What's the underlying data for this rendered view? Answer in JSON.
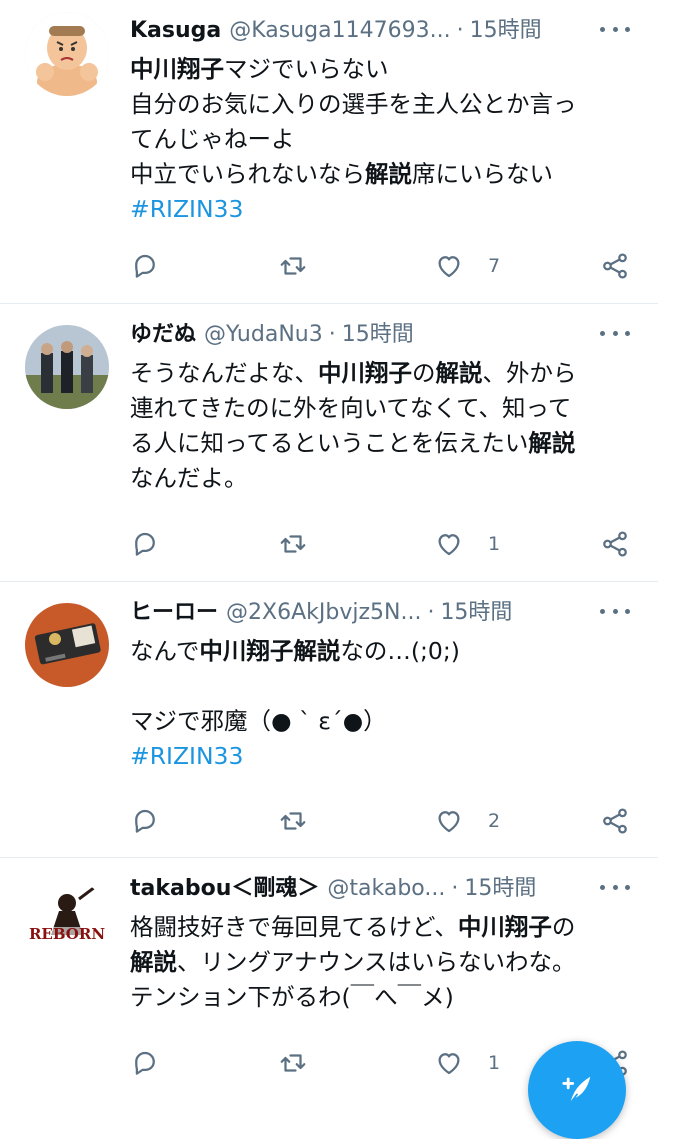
{
  "tweets": [
    {
      "name": "Kasuga",
      "handle": "@Kasuga1147693...",
      "sep": "·",
      "time": "15時間",
      "lines": [
        [
          {
            "t": "中川翔子",
            "s": "hl"
          },
          {
            "t": "マジでいらない"
          }
        ],
        [
          {
            "t": "自分のお気に入りの選手を主人公とか言っ"
          }
        ],
        [
          {
            "t": "てんじゃねーよ"
          }
        ],
        [
          {
            "t": "中立でいられないなら"
          },
          {
            "t": "解説",
            "s": "hl"
          },
          {
            "t": "席にいらない"
          }
        ],
        [
          {
            "t": "#RIZIN33",
            "s": "tag"
          }
        ]
      ],
      "likes": "7"
    },
    {
      "name": "ゆだぬ",
      "handle": "@YudaNu3",
      "sep": "·",
      "time": "15時間",
      "lines": [
        [
          {
            "t": "そうなんだよな、"
          },
          {
            "t": "中川翔子",
            "s": "hl"
          },
          {
            "t": "の"
          },
          {
            "t": "解説",
            "s": "hl"
          },
          {
            "t": "、外から"
          }
        ],
        [
          {
            "t": "連れてきたのに外を向いてなくて、知って"
          }
        ],
        [
          {
            "t": "る人に知ってるということを伝えたい"
          },
          {
            "t": "解説",
            "s": "hl"
          }
        ],
        [
          {
            "t": "なんだよ。"
          }
        ]
      ],
      "likes": "1"
    },
    {
      "name": "ヒーロー",
      "handle": "@2X6AkJbvjz5N...",
      "sep": "·",
      "time": "15時間",
      "lines": [
        [
          {
            "t": "なんで"
          },
          {
            "t": "中川翔子解説",
            "s": "hl"
          },
          {
            "t": "なの…(;0;)"
          }
        ],
        [
          {
            "t": ""
          }
        ],
        [
          {
            "t": "マジで邪魔（● ` ε´●）"
          }
        ],
        [
          {
            "t": "#RIZIN33",
            "s": "tag"
          }
        ]
      ],
      "likes": "2"
    },
    {
      "name": "takabou＜剛魂＞",
      "handle": "@takabo...",
      "sep": "·",
      "time": "15時間",
      "lines": [
        [
          {
            "t": "格闘技好きで毎回見てるけど、"
          },
          {
            "t": "中川翔子",
            "s": "hl"
          },
          {
            "t": "の"
          }
        ],
        [
          {
            "t": "解説",
            "s": "hl"
          },
          {
            "t": "、リングアナウンスはいらないわな。"
          }
        ],
        [
          {
            "t": "テンション下がるわ(￣へ￣メ)"
          }
        ]
      ],
      "likes": "1"
    }
  ],
  "avatar4_text": "REBORN",
  "icons": {
    "reply": "reply-icon",
    "retweet": "retweet-icon",
    "like": "heart-icon",
    "share": "share-icon",
    "more": "more-icon",
    "compose": "compose-tweet-icon"
  },
  "colors": {
    "text": "#0f1419",
    "secondary": "#5b7083",
    "hashtag": "#1b95e0",
    "fab": "#1da1f2",
    "divider": "#e6ecf0"
  }
}
